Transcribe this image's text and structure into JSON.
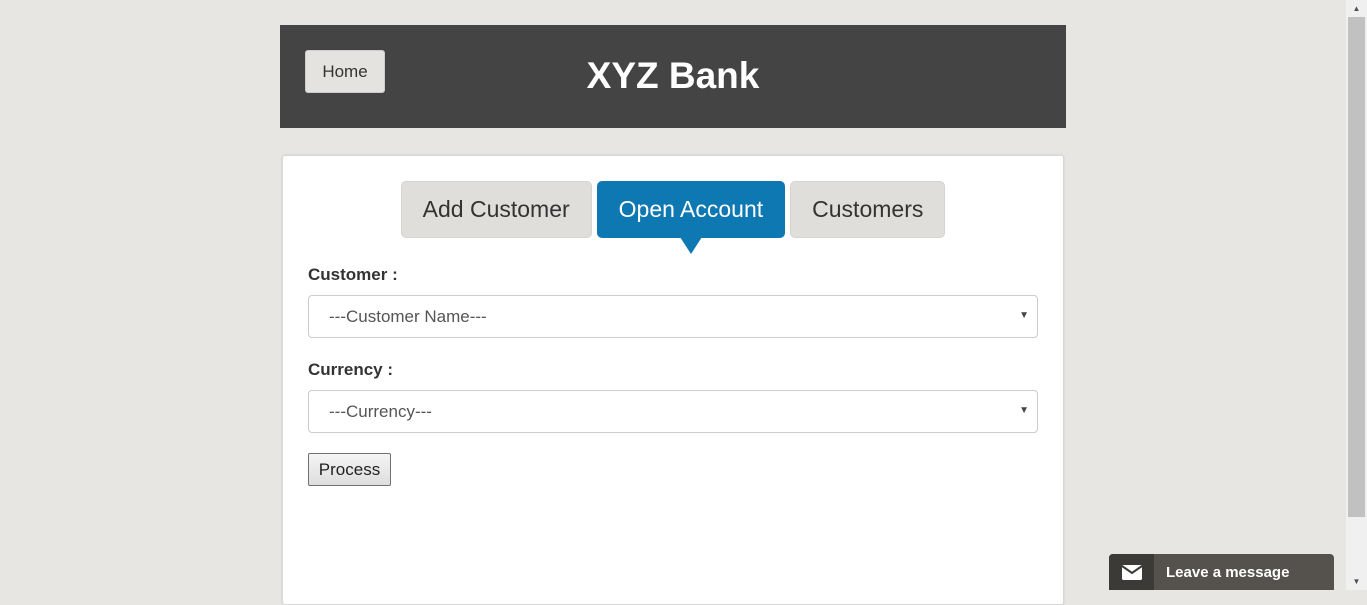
{
  "header": {
    "home_label": "Home",
    "title": "XYZ Bank"
  },
  "tabs": [
    {
      "label": "Add Customer",
      "active": false
    },
    {
      "label": "Open Account",
      "active": true
    },
    {
      "label": "Customers",
      "active": false
    }
  ],
  "form": {
    "customer_label": "Customer :",
    "customer_selected": "---Customer Name---",
    "currency_label": "Currency :",
    "currency_selected": "---Currency---",
    "process_label": "Process"
  },
  "chat": {
    "label": "Leave a message",
    "icon": "envelope-icon"
  },
  "colors": {
    "header_bg": "#444444",
    "active_tab": "#0e78b2",
    "page_bg": "#e8e6e2"
  }
}
